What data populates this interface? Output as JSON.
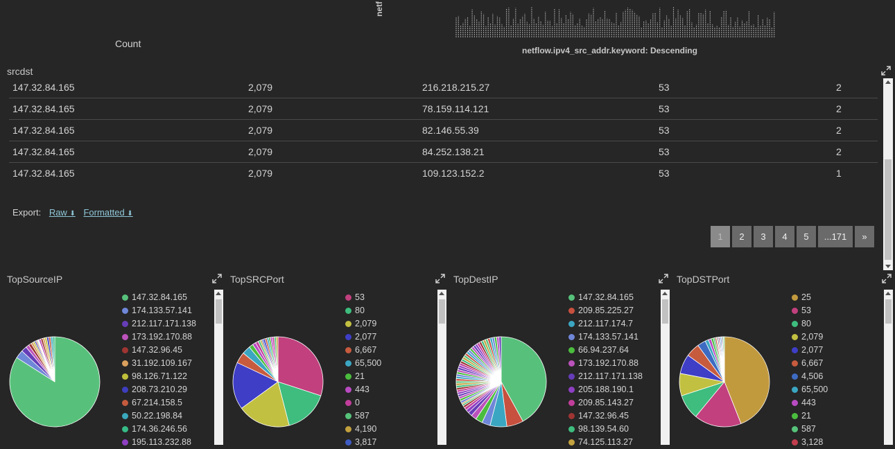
{
  "top": {
    "count_label": "Count",
    "netf_fragment": "netf",
    "axis_title": "netflow.ipv4_src_addr.keyword: Descending"
  },
  "srcdst": {
    "title": "srcdst",
    "rows": [
      {
        "src": "147.32.84.165",
        "sport": "2,079",
        "dst": "216.218.215.27",
        "dport": "53",
        "count": "2"
      },
      {
        "src": "147.32.84.165",
        "sport": "2,079",
        "dst": "78.159.114.121",
        "dport": "53",
        "count": "2"
      },
      {
        "src": "147.32.84.165",
        "sport": "2,079",
        "dst": "82.146.55.39",
        "dport": "53",
        "count": "2"
      },
      {
        "src": "147.32.84.165",
        "sport": "2,079",
        "dst": "84.252.138.21",
        "dport": "53",
        "count": "2"
      },
      {
        "src": "147.32.84.165",
        "sport": "2,079",
        "dst": "109.123.152.2",
        "dport": "53",
        "count": "1"
      }
    ],
    "export_label": "Export:",
    "export_raw": "Raw",
    "export_formatted": "Formatted",
    "download_icon": "download-icon",
    "pager": [
      "1",
      "2",
      "3",
      "4",
      "5",
      "...171",
      "»"
    ],
    "pager_active": "1"
  },
  "panels": [
    {
      "title": "TopSourceIP",
      "legend": [
        {
          "label": "147.32.84.165",
          "color": "#57c17b"
        },
        {
          "label": "174.133.57.141",
          "color": "#6f87d8"
        },
        {
          "label": "212.117.171.138",
          "color": "#663db8"
        },
        {
          "label": "173.192.170.88",
          "color": "#bc52bc"
        },
        {
          "label": "147.32.96.45",
          "color": "#9e3533"
        },
        {
          "label": "31.192.109.167",
          "color": "#daa05d"
        },
        {
          "label": "98.126.71.122",
          "color": "#bfbf3b"
        },
        {
          "label": "208.73.210.29",
          "color": "#3e3ebf"
        },
        {
          "label": "67.214.158.5",
          "color": "#c45b3e"
        },
        {
          "label": "50.22.198.84",
          "color": "#3aa8bd"
        },
        {
          "label": "174.36.246.56",
          "color": "#37bb87"
        },
        {
          "label": "195.113.232.88",
          "color": "#8e3fc2"
        }
      ],
      "slices": [
        84,
        3,
        2,
        1.2,
        1,
        0.8,
        0.6,
        0.5,
        0.4,
        0.3,
        0.2,
        0.2
      ]
    },
    {
      "title": "TopSRCPort",
      "legend": [
        {
          "label": "53",
          "color": "#c2407e"
        },
        {
          "label": "80",
          "color": "#3ebd7e"
        },
        {
          "label": "2,079",
          "color": "#c2c041"
        },
        {
          "label": "2,077",
          "color": "#3e3ec7"
        },
        {
          "label": "6,667",
          "color": "#c75b3e"
        },
        {
          "label": "65,500",
          "color": "#3ba6c2"
        },
        {
          "label": "21",
          "color": "#4bbd3e"
        },
        {
          "label": "443",
          "color": "#b94bc2"
        },
        {
          "label": "0",
          "color": "#c23e9b"
        },
        {
          "label": "587",
          "color": "#56c27a"
        },
        {
          "label": "4,190",
          "color": "#c2a13e"
        },
        {
          "label": "3,817",
          "color": "#3e5bc2"
        }
      ],
      "slices": [
        30,
        16,
        19,
        17,
        4,
        3,
        1.5,
        1.2,
        1,
        0.8,
        0.6,
        0.5
      ]
    },
    {
      "title": "TopDestIP",
      "legend": [
        {
          "label": "147.32.84.165",
          "color": "#57c17b"
        },
        {
          "label": "209.85.225.27",
          "color": "#c7503e"
        },
        {
          "label": "212.117.174.7",
          "color": "#3ba6c2"
        },
        {
          "label": "174.133.57.141",
          "color": "#6f87d8"
        },
        {
          "label": "66.94.237.64",
          "color": "#4bbd3e"
        },
        {
          "label": "173.192.170.88",
          "color": "#bc52bc"
        },
        {
          "label": "212.117.171.138",
          "color": "#663db8"
        },
        {
          "label": "205.188.190.1",
          "color": "#8e3fc2"
        },
        {
          "label": "209.85.143.27",
          "color": "#c23e9b"
        },
        {
          "label": "147.32.96.45",
          "color": "#9e3533"
        },
        {
          "label": "98.139.54.60",
          "color": "#3ebd7e"
        },
        {
          "label": "74.125.113.27",
          "color": "#c2a13e"
        }
      ],
      "slices": [
        42,
        6,
        6,
        3,
        2.5,
        2,
        1.5,
        1.2,
        1,
        0.8,
        0.6,
        0.5
      ]
    },
    {
      "title": "TopDSTPort",
      "legend": [
        {
          "label": "25",
          "color": "#c29a3e"
        },
        {
          "label": "53",
          "color": "#c2407e"
        },
        {
          "label": "80",
          "color": "#3ebd7e"
        },
        {
          "label": "2,079",
          "color": "#c2c041"
        },
        {
          "label": "2,077",
          "color": "#3e3ec7"
        },
        {
          "label": "6,667",
          "color": "#c75b3e"
        },
        {
          "label": "4,506",
          "color": "#3e6bc2"
        },
        {
          "label": "65,500",
          "color": "#3ba6c2"
        },
        {
          "label": "443",
          "color": "#b94bc2"
        },
        {
          "label": "21",
          "color": "#4bbd3e"
        },
        {
          "label": "587",
          "color": "#56c27a"
        },
        {
          "label": "3,128",
          "color": "#c23e4e"
        }
      ],
      "slices": [
        44,
        17,
        9,
        8,
        7,
        5,
        3,
        1.2,
        1,
        0.8,
        0.6,
        0.5
      ]
    }
  ]
}
